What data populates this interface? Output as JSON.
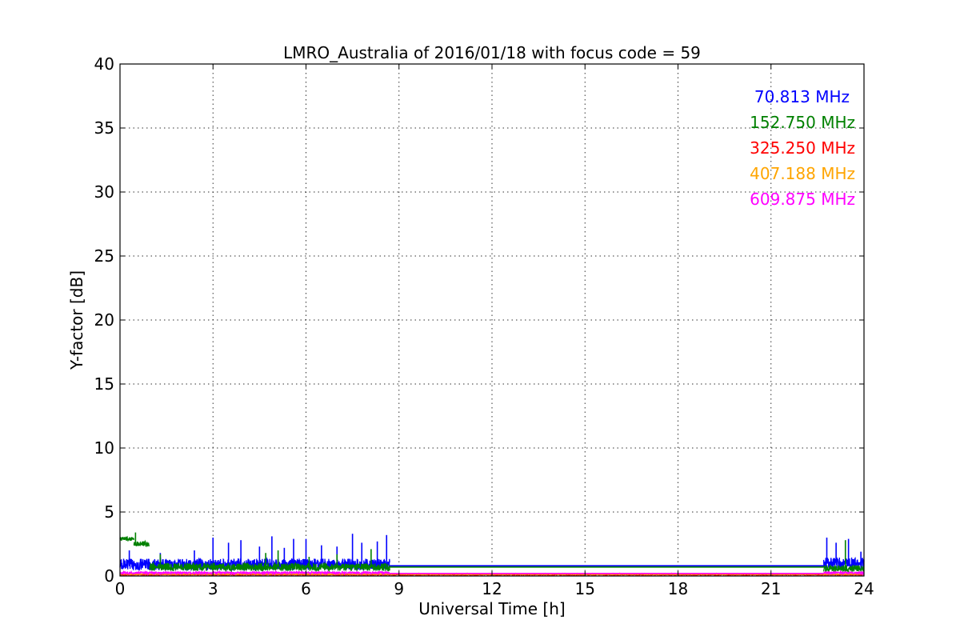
{
  "chart_data": {
    "type": "line",
    "title": "LMRO_Australia of 2016/01/18 with focus code = 59",
    "xlabel": "Universal Time [h]",
    "ylabel": "Y-factor [dB]",
    "xlim": [
      0,
      24
    ],
    "ylim": [
      0,
      40
    ],
    "x_ticks": [
      "0",
      "3",
      "6",
      "9",
      "12",
      "15",
      "18",
      "21",
      "24"
    ],
    "y_ticks": [
      "0",
      "5",
      "10",
      "15",
      "20",
      "25",
      "30",
      "35",
      "40"
    ],
    "grid": true,
    "legend_placement": "top-right",
    "series": [
      {
        "name": "70.813 MHz",
        "color": "#0000ff",
        "segments": [
          {
            "x_start": 0.0,
            "x_end": 8.7,
            "baseline": 0.9,
            "noise": 0.45,
            "spikes": [
              [
                0.3,
                2.0
              ],
              [
                1.3,
                1.8
              ],
              [
                2.4,
                2.0
              ],
              [
                3.0,
                3.0
              ],
              [
                3.5,
                2.6
              ],
              [
                3.9,
                2.8
              ],
              [
                4.5,
                2.3
              ],
              [
                4.9,
                3.1
              ],
              [
                5.3,
                2.2
              ],
              [
                5.6,
                2.9
              ],
              [
                6.0,
                2.9
              ],
              [
                6.5,
                2.4
              ],
              [
                7.0,
                2.3
              ],
              [
                7.5,
                3.3
              ],
              [
                7.8,
                2.6
              ],
              [
                8.3,
                2.7
              ],
              [
                8.6,
                3.2
              ]
            ]
          },
          {
            "x_start": 8.7,
            "x_end": 22.7,
            "baseline": 0.8,
            "noise": 0.0,
            "spikes": []
          },
          {
            "x_start": 22.7,
            "x_end": 24.0,
            "baseline": 1.0,
            "noise": 0.45,
            "spikes": [
              [
                22.8,
                3.0
              ],
              [
                23.1,
                2.6
              ],
              [
                23.5,
                2.9
              ],
              [
                23.9,
                1.9
              ]
            ]
          }
        ]
      },
      {
        "name": "152.750 MHz",
        "color": "#008000",
        "segments": [
          {
            "x_start": 0.0,
            "x_end": 0.45,
            "baseline": 2.9,
            "noise": 0.15,
            "spikes": []
          },
          {
            "x_start": 0.45,
            "x_end": 0.95,
            "baseline": 2.5,
            "noise": 0.2,
            "spikes": [
              [
                0.5,
                3.4
              ]
            ]
          },
          {
            "x_start": 0.95,
            "x_end": 8.7,
            "baseline": 0.7,
            "noise": 0.3,
            "spikes": [
              [
                1.3,
                1.7
              ],
              [
                4.7,
                1.8
              ],
              [
                5.1,
                2.0
              ],
              [
                6.1,
                1.5
              ],
              [
                7.0,
                1.7
              ],
              [
                8.1,
                2.1
              ]
            ]
          },
          {
            "x_start": 8.7,
            "x_end": 22.7,
            "baseline": 0.7,
            "noise": 0.0,
            "spikes": []
          },
          {
            "x_start": 22.7,
            "x_end": 24.0,
            "baseline": 0.6,
            "noise": 0.25,
            "spikes": [
              [
                23.4,
                2.8
              ]
            ]
          }
        ]
      },
      {
        "name": "325.250 MHz",
        "color": "#ff0000",
        "segments": [
          {
            "x_start": 0.0,
            "x_end": 24.0,
            "baseline": 0.1,
            "noise": 0.03,
            "spikes": []
          }
        ]
      },
      {
        "name": "407.188 MHz",
        "color": "#ffa500",
        "segments": [
          {
            "x_start": 0.0,
            "x_end": 24.0,
            "baseline": 0.15,
            "noise": 0.03,
            "spikes": []
          }
        ]
      },
      {
        "name": "609.875 MHz",
        "color": "#ff00ff",
        "segments": [
          {
            "x_start": 0.0,
            "x_end": 8.7,
            "baseline": 0.25,
            "noise": 0.08,
            "spikes": []
          },
          {
            "x_start": 8.7,
            "x_end": 22.7,
            "baseline": 0.2,
            "noise": 0.0,
            "spikes": []
          },
          {
            "x_start": 22.7,
            "x_end": 24.0,
            "baseline": 0.25,
            "noise": 0.08,
            "spikes": []
          }
        ]
      }
    ]
  }
}
